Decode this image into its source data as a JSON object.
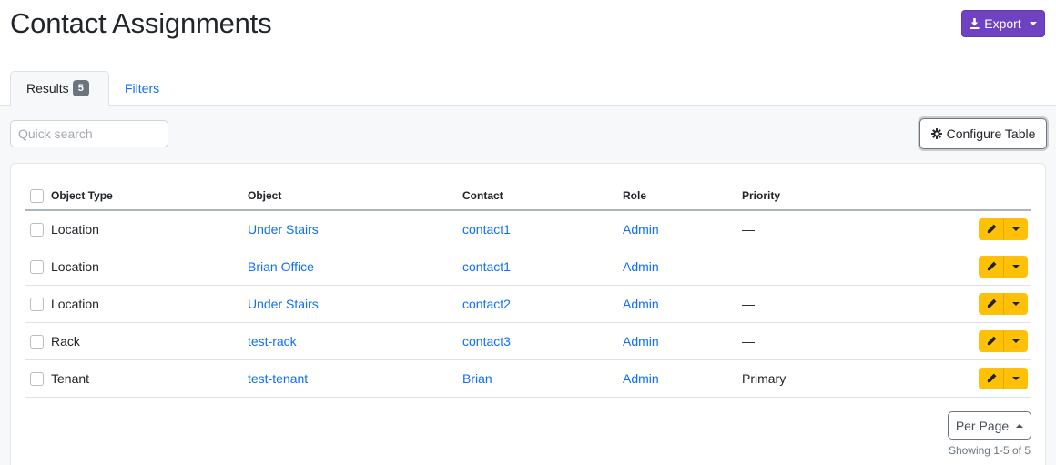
{
  "page": {
    "title": "Contact Assignments"
  },
  "export": {
    "label": "Export",
    "icon": "download-icon"
  },
  "tabs": [
    {
      "label": "Results",
      "badge": "5",
      "active": true
    },
    {
      "label": "Filters",
      "active": false
    }
  ],
  "search": {
    "placeholder": "Quick search",
    "value": ""
  },
  "configure": {
    "label": "Configure Table",
    "icon": "gear-icon"
  },
  "table": {
    "headers": [
      "Object Type",
      "Object",
      "Contact",
      "Role",
      "Priority"
    ],
    "rows": [
      {
        "object_type": "Location",
        "object": "Under Stairs",
        "contact": "contact1",
        "role": "Admin",
        "priority": "—"
      },
      {
        "object_type": "Location",
        "object": "Brian Office",
        "contact": "contact1",
        "role": "Admin",
        "priority": "—"
      },
      {
        "object_type": "Location",
        "object": "Under Stairs",
        "contact": "contact2",
        "role": "Admin",
        "priority": "—"
      },
      {
        "object_type": "Rack",
        "object": "test-rack",
        "contact": "contact3",
        "role": "Admin",
        "priority": "—"
      },
      {
        "object_type": "Tenant",
        "object": "test-tenant",
        "contact": "Brian",
        "role": "Admin",
        "priority": "Primary"
      }
    ]
  },
  "pagination": {
    "per_page_label": "Per Page",
    "showing": "Showing 1-5 of 5"
  },
  "colors": {
    "accent": "#6f42c1",
    "link": "#0d6efd",
    "warning": "#ffc107",
    "badge": "#6c757d"
  }
}
